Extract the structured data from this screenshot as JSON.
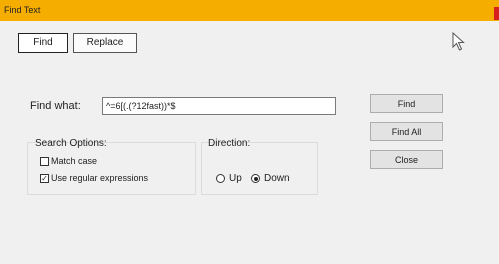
{
  "window": {
    "title": "Find Text"
  },
  "tabs": [
    {
      "label": "Find",
      "active": true
    },
    {
      "label": "Replace",
      "active": false
    }
  ],
  "find": {
    "label": "Find what:",
    "value": "^=6[(.(?12fast))*$"
  },
  "buttons": {
    "find": "Find",
    "find_all": "Find All",
    "close": "Close"
  },
  "search_options": {
    "title": "Search Options:",
    "match_case": {
      "label": "Match case",
      "checked": false
    },
    "regex": {
      "label": "Use regular expressions",
      "checked": true
    }
  },
  "direction": {
    "title": "Direction:",
    "up": {
      "label": "Up",
      "selected": false
    },
    "down": {
      "label": "Down",
      "selected": true
    }
  },
  "colors": {
    "titlebar": "#f5ad00",
    "close_mark": "#d62020"
  },
  "icons": {
    "cursor": "mouse-pointer-icon"
  }
}
